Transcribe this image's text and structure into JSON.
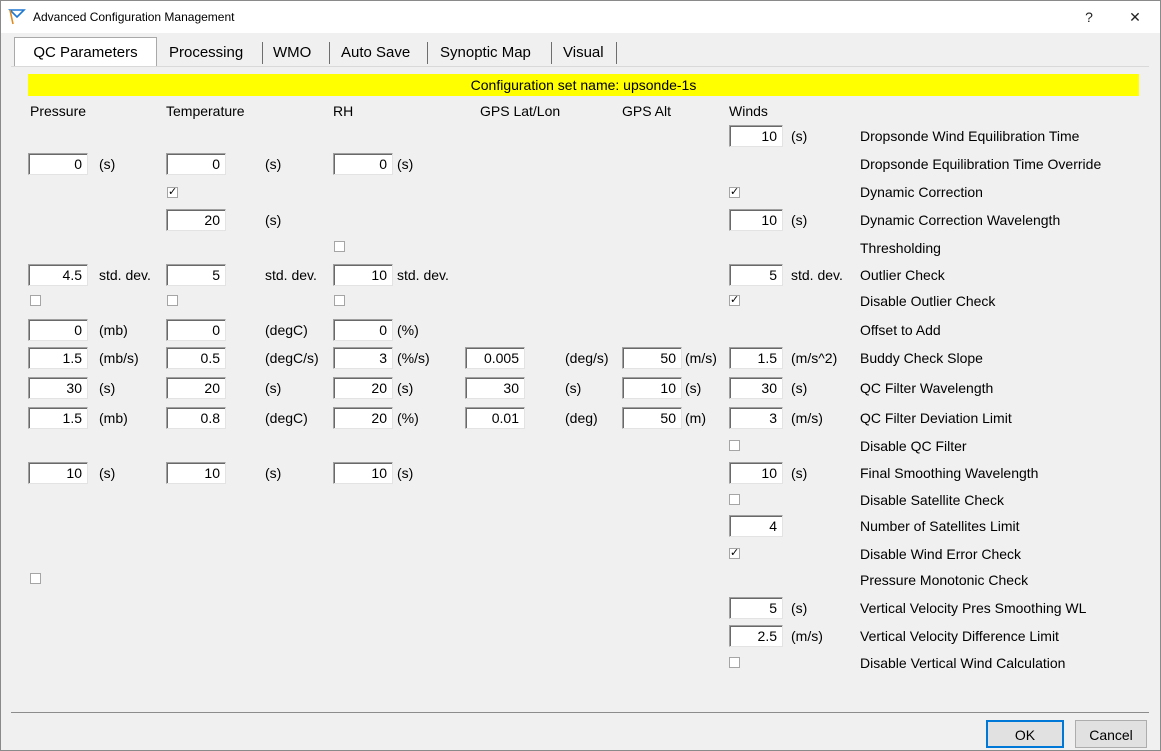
{
  "window": {
    "title": "Advanced Configuration Management",
    "help_label": "?",
    "close_label": "✕"
  },
  "tabs": [
    "QC Parameters",
    "Processing",
    "WMO",
    "Auto Save",
    "Synoptic Map",
    "Visual"
  ],
  "banner": "Configuration set name: upsonde-1s",
  "columns": [
    "Pressure",
    "Temperature",
    "RH",
    "GPS Lat/Lon",
    "GPS Alt",
    "Winds"
  ],
  "rows": {
    "wind_equil": {
      "label": "Dropsonde Wind Equilibration Time",
      "winds": {
        "value": "10",
        "unit": "(s)"
      }
    },
    "equil_override": {
      "label": "Dropsonde Equilibration Time Override",
      "pressure": {
        "value": "0",
        "unit": "(s)"
      },
      "temperature": {
        "value": "0",
        "unit": "(s)"
      },
      "rh": {
        "value": "0",
        "unit": "(s)"
      }
    },
    "dyn_corr": {
      "label": "Dynamic Correction",
      "temperature_checked": true,
      "winds_checked": true
    },
    "dyn_corr_wl": {
      "label": "Dynamic Correction Wavelength",
      "temperature": {
        "value": "20",
        "unit": "(s)"
      },
      "winds": {
        "value": "10",
        "unit": "(s)"
      }
    },
    "thresholding": {
      "label": "Thresholding",
      "rh_checked": false
    },
    "outlier": {
      "label": "Outlier Check",
      "pressure": {
        "value": "4.5",
        "unit": "std. dev."
      },
      "temperature": {
        "value": "5",
        "unit": "std. dev."
      },
      "rh": {
        "value": "10",
        "unit": "std. dev."
      },
      "winds": {
        "value": "5",
        "unit": "std. dev."
      }
    },
    "disable_outlier": {
      "label": "Disable Outlier Check",
      "pressure_checked": false,
      "temperature_checked": false,
      "rh_checked": false,
      "winds_checked": true
    },
    "offset": {
      "label": "Offset to Add",
      "pressure": {
        "value": "0",
        "unit": "(mb)"
      },
      "temperature": {
        "value": "0",
        "unit": "(degC)"
      },
      "rh": {
        "value": "0",
        "unit": "(%)"
      }
    },
    "buddy": {
      "label": "Buddy Check Slope",
      "pressure": {
        "value": "1.5",
        "unit": "(mb/s)"
      },
      "temperature": {
        "value": "0.5",
        "unit": "(degC/s)"
      },
      "rh": {
        "value": "3",
        "unit": "(%/s)"
      },
      "gps_latlon": {
        "value": "0.005",
        "unit": "(deg/s)"
      },
      "gps_alt": {
        "value": "50",
        "unit": "(m/s)"
      },
      "winds": {
        "value": "1.5",
        "unit": "(m/s^2)"
      }
    },
    "qc_wl": {
      "label": "QC Filter Wavelength",
      "pressure": {
        "value": "30",
        "unit": "(s)"
      },
      "temperature": {
        "value": "20",
        "unit": "(s)"
      },
      "rh": {
        "value": "20",
        "unit": "(s)"
      },
      "gps_latlon": {
        "value": "30",
        "unit": "(s)"
      },
      "gps_alt": {
        "value": "10",
        "unit": "(s)"
      },
      "winds": {
        "value": "30",
        "unit": "(s)"
      }
    },
    "qc_dev": {
      "label": "QC Filter Deviation Limit",
      "pressure": {
        "value": "1.5",
        "unit": "(mb)"
      },
      "temperature": {
        "value": "0.8",
        "unit": "(degC)"
      },
      "rh": {
        "value": "20",
        "unit": "(%)"
      },
      "gps_latlon": {
        "value": "0.01",
        "unit": "(deg)"
      },
      "gps_alt": {
        "value": "50",
        "unit": "(m)"
      },
      "winds": {
        "value": "3",
        "unit": "(m/s)"
      }
    },
    "disable_qc": {
      "label": "Disable QC Filter",
      "winds_checked": false
    },
    "final_smooth": {
      "label": "Final Smoothing Wavelength",
      "pressure": {
        "value": "10",
        "unit": "(s)"
      },
      "temperature": {
        "value": "10",
        "unit": "(s)"
      },
      "rh": {
        "value": "10",
        "unit": "(s)"
      },
      "winds": {
        "value": "10",
        "unit": "(s)"
      }
    },
    "disable_sat": {
      "label": "Disable Satellite Check",
      "winds_checked": false
    },
    "num_sat": {
      "label": "Number of Satellites Limit",
      "winds": {
        "value": "4"
      }
    },
    "disable_wind_err": {
      "label": "Disable Wind Error Check",
      "winds_checked": true
    },
    "pres_mono": {
      "label": "Pressure Monotonic Check",
      "pressure_checked": false
    },
    "vv_smooth": {
      "label": "Vertical Velocity Pres Smoothing WL",
      "winds": {
        "value": "5",
        "unit": "(s)"
      }
    },
    "vv_diff": {
      "label": "Vertical Velocity Difference Limit",
      "winds": {
        "value": "2.5",
        "unit": "(m/s)"
      }
    },
    "disable_vert": {
      "label": "Disable Vertical Wind Calculation",
      "winds_checked": false
    }
  },
  "buttons": {
    "ok": "OK",
    "cancel": "Cancel"
  },
  "colors": {
    "banner": "#ffff00",
    "accent": "#0078d7"
  }
}
